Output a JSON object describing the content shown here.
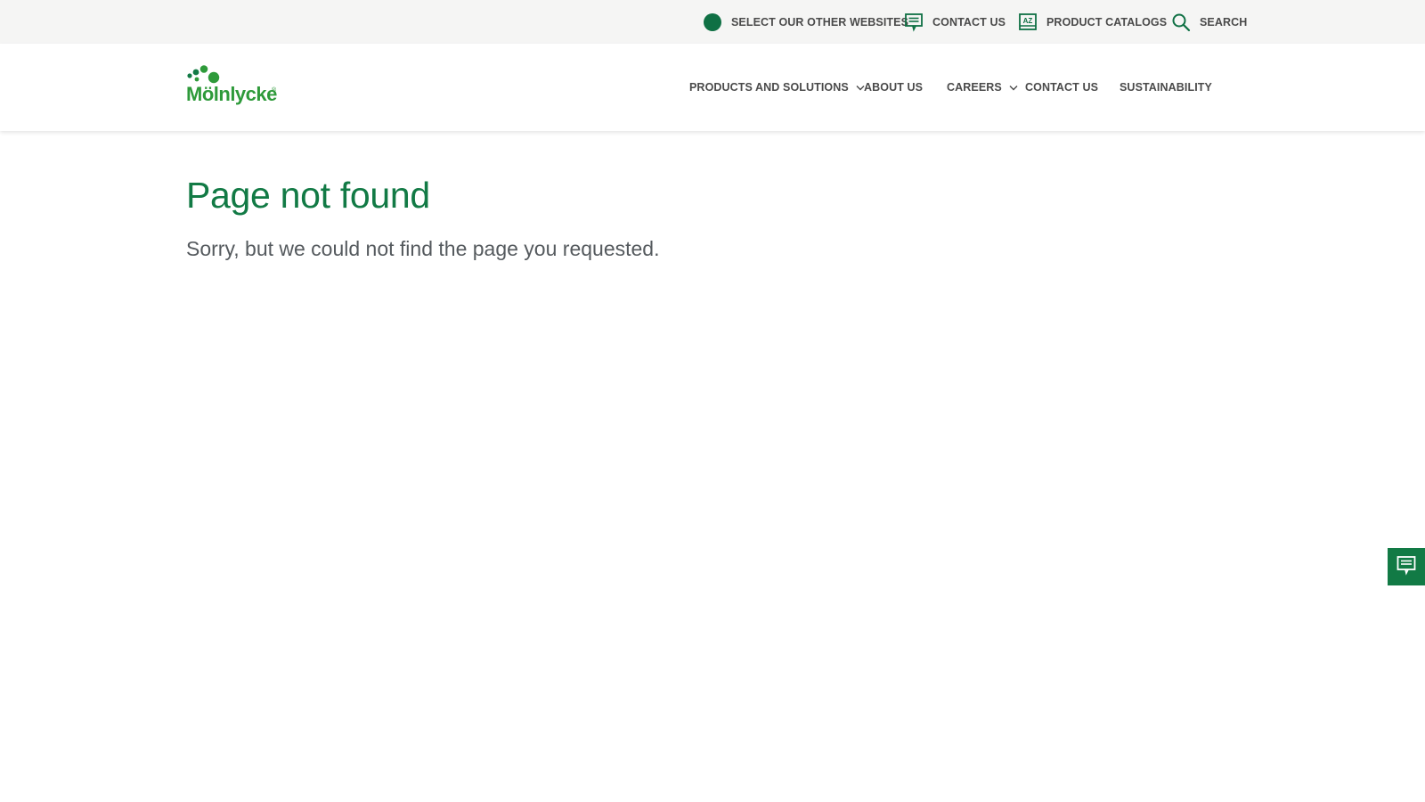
{
  "utility_bar": {
    "select_websites": "SELECT OUR OTHER WEBSITES",
    "contact_us": "CONTACT US",
    "product_catalogs": "PRODUCT CATALOGS",
    "search": "SEARCH"
  },
  "brand": {
    "logo_text": "Mölnlycke",
    "registered_mark": "®",
    "brand_green": "#127a45",
    "logo_green": "#2e9a3a"
  },
  "nav": {
    "items": [
      {
        "label": "PRODUCTS AND SOLUTIONS",
        "has_dropdown": true
      },
      {
        "label": "ABOUT US",
        "has_dropdown": false
      },
      {
        "label": "CAREERS",
        "has_dropdown": true
      },
      {
        "label": "CONTACT US",
        "has_dropdown": false
      },
      {
        "label": "SUSTAINABILITY",
        "has_dropdown": false
      }
    ]
  },
  "content": {
    "title": "Page not found",
    "message": "Sorry, but we could not find the page you requested."
  },
  "icons": {
    "globe": "globe-icon",
    "contact": "chat-icon",
    "catalog": "catalog-az-icon",
    "search": "search-icon",
    "dropdown": "chevron-down-icon",
    "feedback": "chat-icon"
  }
}
